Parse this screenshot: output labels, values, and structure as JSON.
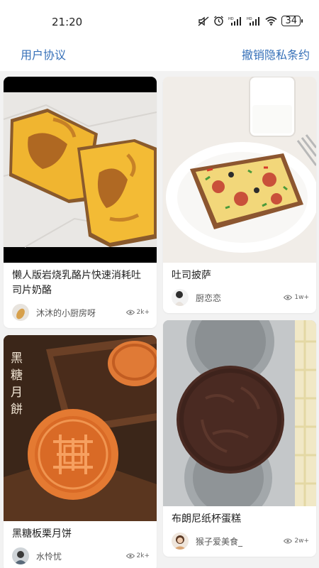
{
  "status_bar": {
    "time": "21:20",
    "battery": "34"
  },
  "header": {
    "left_link": "用户协议",
    "right_link": "撤销隐私条约"
  },
  "feed": {
    "left": [
      {
        "title": "懒人版岩烧乳酪片快速消耗吐司片奶酪",
        "author": "沐沐的小厨房呀",
        "views": "2k+"
      },
      {
        "title": "黑糖板栗月饼",
        "author": "水怜忧",
        "views": "2k+"
      }
    ],
    "right": [
      {
        "title": "吐司披萨",
        "author": "厨恋恋",
        "views": "1w+"
      },
      {
        "title": "布朗尼纸杯蛋糕",
        "author": "猴子爱美食_",
        "views": "2w+"
      }
    ]
  },
  "image_text": {
    "mooncake_sign": "黑糖月餅"
  },
  "colors": {
    "accent": "#3670b8",
    "background": "#f2f2f2",
    "card": "#ffffff"
  }
}
